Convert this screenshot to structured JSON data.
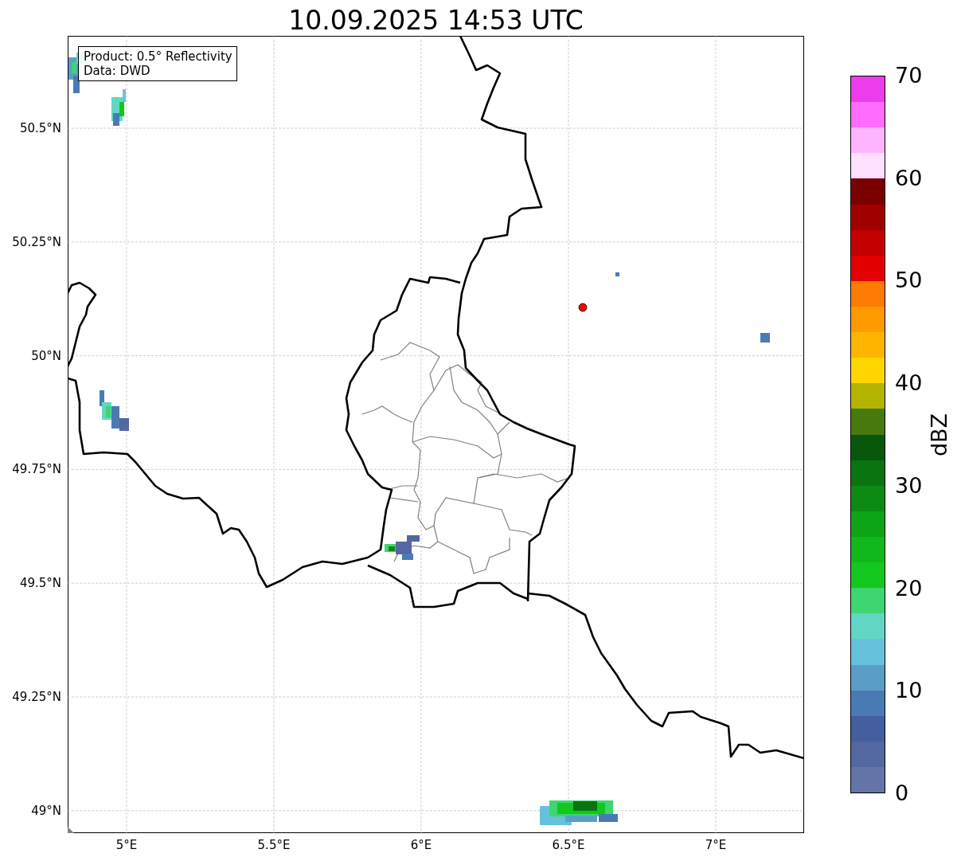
{
  "title": "10.09.2025 14:53 UTC",
  "legend": [
    "Product: 0.5° Reflectivity",
    "Data: DWD"
  ],
  "map": {
    "yticks": [
      "50.5°N",
      "50.25°N",
      "50°N",
      "49.75°N",
      "49.5°N",
      "49.25°N",
      "49°N"
    ],
    "xticks": [
      "5°E",
      "5.5°E",
      "6°E",
      "6.5°E",
      "7°E"
    ]
  },
  "colorbar": {
    "label": "dBZ",
    "ticks": [
      "70",
      "60",
      "50",
      "40",
      "30",
      "20",
      "10",
      "0"
    ],
    "segments": [
      {
        "color": "#ec3cec"
      },
      {
        "color": "#ff6cff"
      },
      {
        "color": "#ffb4ff"
      },
      {
        "color": "#ffe0ff"
      },
      {
        "color": "#7a0000"
      },
      {
        "color": "#a00000"
      },
      {
        "color": "#c40000"
      },
      {
        "color": "#e40000"
      },
      {
        "color": "#ff7a00"
      },
      {
        "color": "#ff9a00"
      },
      {
        "color": "#ffb400"
      },
      {
        "color": "#ffd600"
      },
      {
        "color": "#b4b400"
      },
      {
        "color": "#467a0c"
      },
      {
        "color": "#08580c"
      },
      {
        "color": "#0a7410"
      },
      {
        "color": "#0c8a14"
      },
      {
        "color": "#0ea418"
      },
      {
        "color": "#10b81c"
      },
      {
        "color": "#12c81e"
      },
      {
        "color": "#3dd670"
      },
      {
        "color": "#62d6c4"
      },
      {
        "color": "#66c2dc"
      },
      {
        "color": "#5a9ec8"
      },
      {
        "color": "#4a7ab4"
      },
      {
        "color": "#445ea0"
      },
      {
        "color": "#5367a0"
      },
      {
        "color": "#6474a8"
      }
    ]
  }
}
